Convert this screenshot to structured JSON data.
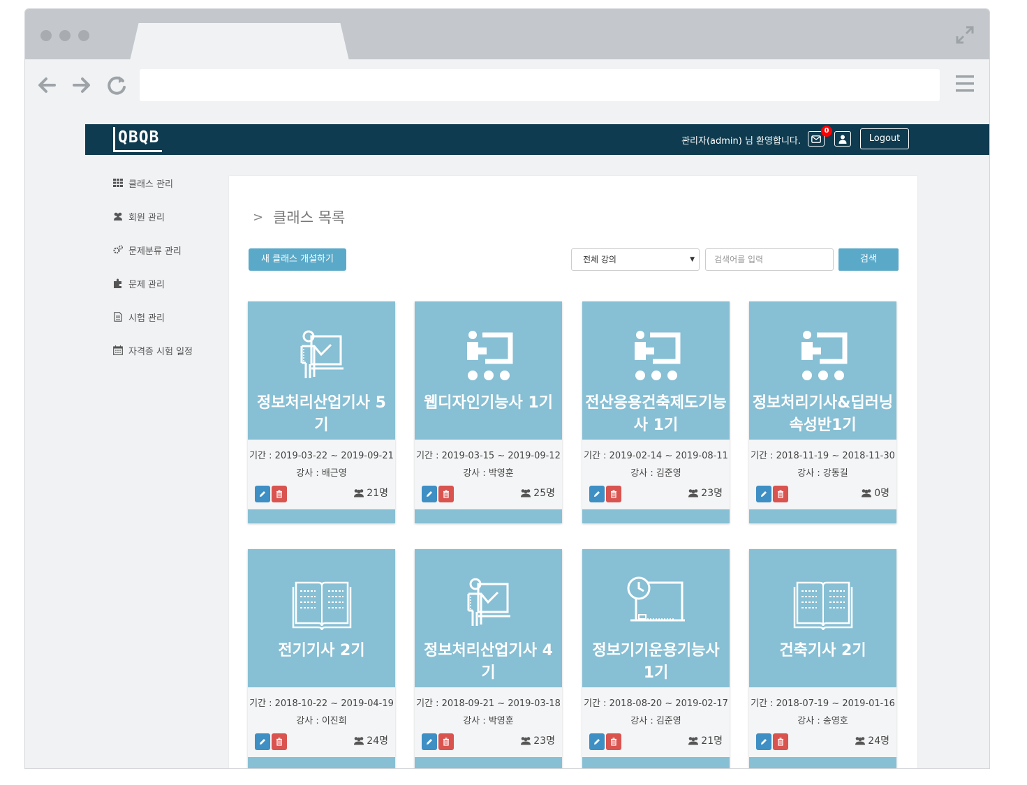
{
  "header": {
    "logo": "QBQB",
    "welcome": "관리자(admin) 님 환영합니다.",
    "mail_badge": "0",
    "logout_label": "Logout"
  },
  "sidebar": {
    "items": [
      {
        "label": "클래스 관리",
        "icon": "grid-icon"
      },
      {
        "label": "회원 관리",
        "icon": "users-icon"
      },
      {
        "label": "문제분류 관리",
        "icon": "cogs-icon"
      },
      {
        "label": "문제 관리",
        "icon": "puzzle-icon"
      },
      {
        "label": "시험 관리",
        "icon": "document-icon"
      },
      {
        "label": "자격증 시험 일정",
        "icon": "calendar-icon"
      }
    ]
  },
  "main": {
    "breadcrumb": "클래스 목록",
    "new_class_label": "새 클래스 개설하기",
    "filter_selected": "전체 강의",
    "search_placeholder": "검색어를 입력",
    "search_label": "검색"
  },
  "cards": [
    {
      "title": "정보처리산업기사 5기",
      "period": "기간 : 2019-03-22 ~ 2019-09-21",
      "teacher": "강사 : 배근영",
      "members": "21명",
      "icon": "teacher-board-icon"
    },
    {
      "title": "웹디자인기능사 1기",
      "period": "기간 : 2019-03-15 ~ 2019-09-12",
      "teacher": "강사 : 박영훈",
      "members": "25명",
      "icon": "classroom-icon"
    },
    {
      "title": "전산응용건축제도기능사 1기",
      "period": "기간 : 2019-02-14 ~ 2019-08-11",
      "teacher": "강사 : 김준영",
      "members": "23명",
      "icon": "classroom-icon"
    },
    {
      "title": "정보처리기사&딥러닝 속성반1기",
      "period": "기간 : 2018-11-19 ~ 2018-11-30",
      "teacher": "강사 : 강동길",
      "members": "0명",
      "icon": "classroom-icon"
    },
    {
      "title": "전기기사 2기",
      "period": "기간 : 2018-10-22 ~ 2019-04-19",
      "teacher": "강사 : 이진희",
      "members": "24명",
      "icon": "open-book-icon"
    },
    {
      "title": "정보처리산업기사 4기",
      "period": "기간 : 2018-09-21 ~ 2019-03-18",
      "teacher": "강사 : 박영훈",
      "members": "23명",
      "icon": "teacher-board-icon"
    },
    {
      "title": "정보기기운용기능사 1기",
      "period": "기간 : 2018-08-20 ~ 2019-02-17",
      "teacher": "강사 : 김준영",
      "members": "21명",
      "icon": "clock-board-icon"
    },
    {
      "title": "건축기사 2기",
      "period": "기간 : 2018-07-19 ~ 2019-01-16",
      "teacher": "강사 : 송영호",
      "members": "24명",
      "icon": "open-book-icon"
    }
  ],
  "colors": {
    "header_bg": "#0e3b4f",
    "card_accent": "#87bfd4",
    "primary_button": "#5ba9c8",
    "edit_button": "#3e8fc4",
    "delete_button": "#d9534f",
    "badge": "#ff0000"
  }
}
